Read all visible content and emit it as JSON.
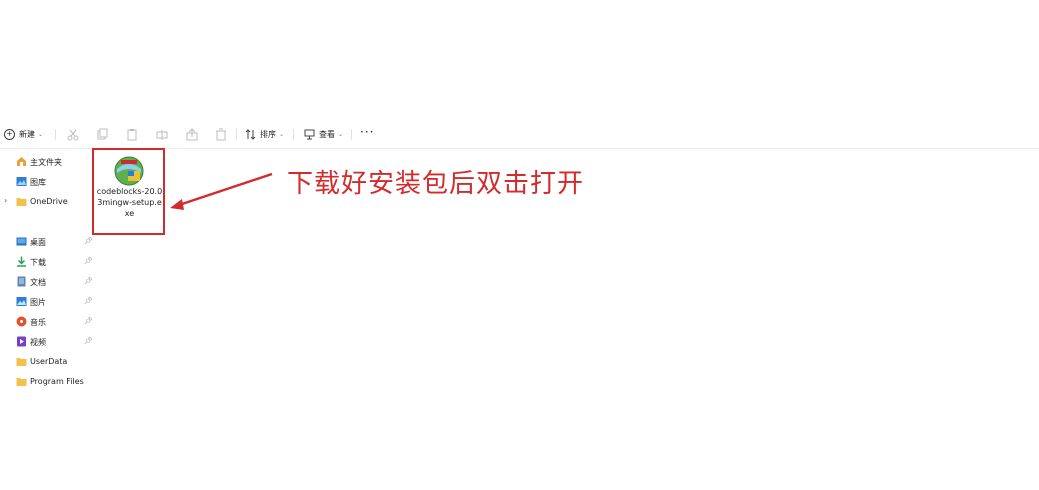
{
  "toolbar": {
    "new_label": "新建",
    "sort_label": "排序",
    "view_label": "查看",
    "more_label": "···"
  },
  "sidebar": {
    "items": [
      {
        "label": "主文件夹"
      },
      {
        "label": "图库"
      },
      {
        "label": "OneDrive"
      },
      {
        "label": "桌面"
      },
      {
        "label": "下载"
      },
      {
        "label": "文档"
      },
      {
        "label": "图片"
      },
      {
        "label": "音乐"
      },
      {
        "label": "视频"
      },
      {
        "label": "UserData"
      },
      {
        "label": "Program Files"
      }
    ]
  },
  "file": {
    "name": "codeblocks-20.03mingw-setup.exe"
  },
  "annotation": {
    "text": "下载好安装包后双击打开"
  },
  "colors": {
    "highlight": "#d12b2b",
    "folder": "#f2c14e"
  }
}
